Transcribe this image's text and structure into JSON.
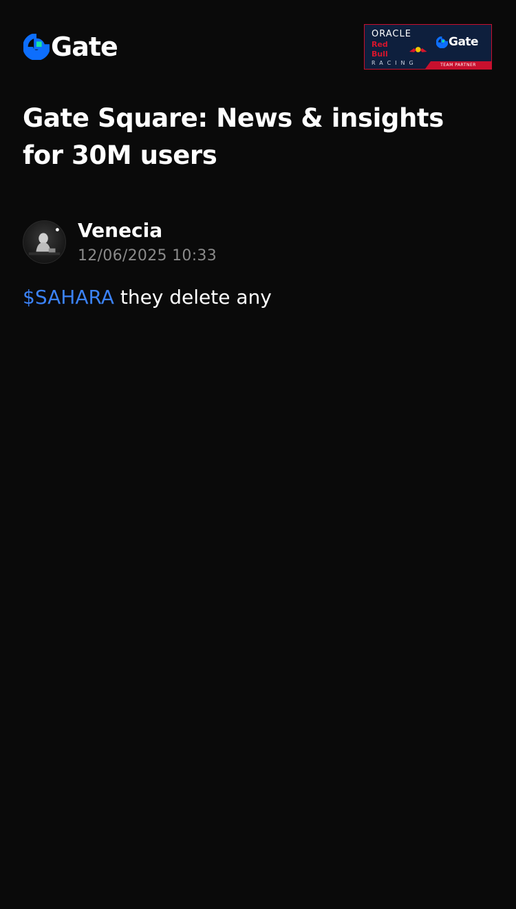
{
  "header": {
    "brand": "Gate",
    "partner_banner": {
      "line1": "ORACLE",
      "line2": "Red Bull",
      "line3": "RACING",
      "brand": "Gate",
      "tag": "TEAM PARTNER"
    }
  },
  "page": {
    "title": "Gate Square: News & insights for 30M users"
  },
  "post": {
    "author": "Venecia",
    "timestamp": "12/06/2025 10:33",
    "ticker": "$SAHARA",
    "text": " they delete any"
  },
  "colors": {
    "background": "#0a0a0a",
    "brand_blue": "#0d6efd",
    "brand_green": "#17e5a1",
    "ticker": "#3b82f6",
    "muted": "#8a8a8a",
    "partner_navy": "#0e1f3d",
    "partner_red": "#c8102e"
  }
}
